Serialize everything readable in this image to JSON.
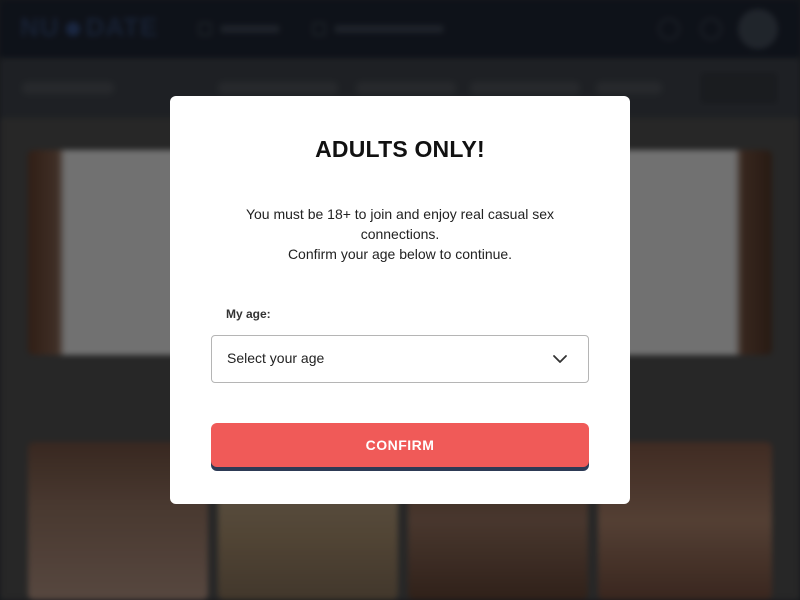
{
  "background": {
    "brand": "NU DATE"
  },
  "modal": {
    "title": "ADULTS ONLY!",
    "message_line1": "You must be 18+ to join and enjoy real casual sex connections.",
    "message_line2": "Confirm your age below to continue.",
    "age_label": "My age:",
    "age_select": {
      "value": "Select your age",
      "icon": "chevron-down-icon"
    },
    "confirm_label": "CONFIRM"
  },
  "colors": {
    "confirm_button": "#f05a58",
    "confirm_shadow": "#2d3a55",
    "topbar": "#1c2330"
  }
}
